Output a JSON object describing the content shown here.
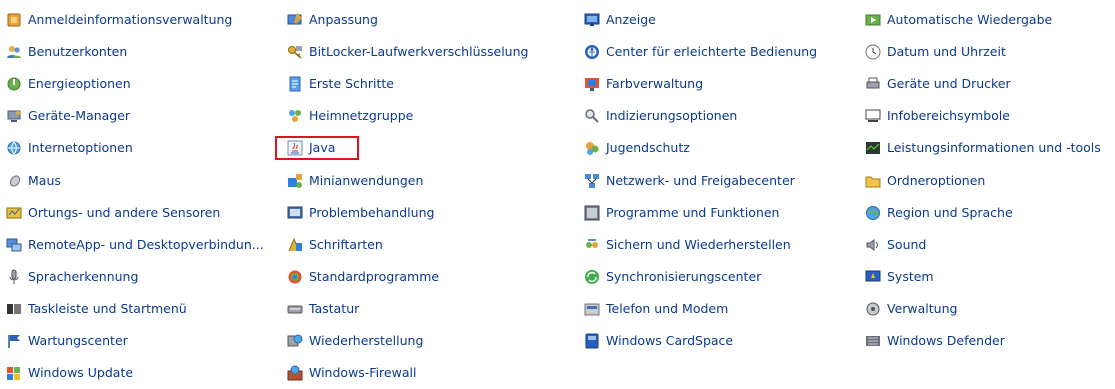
{
  "accent_link_color": "#0b3a8c",
  "highlight_color": "#e0131f",
  "columns": [
    {
      "items": [
        {
          "label": "Anmeldeinformationsverwaltung",
          "icon": "credential-vault-icon",
          "name": "item-anmeldeinformationsverwaltung"
        },
        {
          "label": "Benutzerkonten",
          "icon": "user-accounts-icon",
          "name": "item-benutzerkonten"
        },
        {
          "label": "Energieoptionen",
          "icon": "power-options-icon",
          "name": "item-energieoptionen"
        },
        {
          "label": "Geräte-Manager",
          "icon": "device-manager-icon",
          "name": "item-geraete-manager"
        },
        {
          "label": "Internetoptionen",
          "icon": "internet-options-icon",
          "name": "item-internetoptionen"
        },
        {
          "label": "Maus",
          "icon": "mouse-icon",
          "name": "item-maus"
        },
        {
          "label": "Ortungs- und andere Sensoren",
          "icon": "sensors-icon",
          "name": "item-ortungs-sensoren"
        },
        {
          "label": "RemoteApp- und Desktopverbindun...",
          "icon": "remoteapp-icon",
          "name": "item-remoteapp"
        },
        {
          "label": "Spracherkennung",
          "icon": "speech-recognition-icon",
          "name": "item-spracherkennung"
        },
        {
          "label": "Taskleiste und Startmenü",
          "icon": "taskbar-icon",
          "name": "item-taskleiste"
        },
        {
          "label": "Wartungscenter",
          "icon": "action-center-flag-icon",
          "name": "item-wartungscenter"
        },
        {
          "label": "Windows Update",
          "icon": "windows-update-icon",
          "name": "item-windows-update"
        }
      ]
    },
    {
      "items": [
        {
          "label": "Anpassung",
          "icon": "personalization-icon",
          "name": "item-anpassung"
        },
        {
          "label": "BitLocker-Laufwerkverschlüsselung",
          "icon": "bitlocker-key-icon",
          "name": "item-bitlocker"
        },
        {
          "label": "Erste Schritte",
          "icon": "getting-started-icon",
          "name": "item-erste-schritte"
        },
        {
          "label": "Heimnetzgruppe",
          "icon": "homegroup-icon",
          "name": "item-heimnetzgruppe"
        },
        {
          "label": "Java",
          "icon": "java-icon",
          "name": "item-java",
          "highlighted": true
        },
        {
          "label": "Minianwendungen",
          "icon": "gadgets-icon",
          "name": "item-minianwendungen"
        },
        {
          "label": "Problembehandlung",
          "icon": "troubleshooting-icon",
          "name": "item-problembehandlung"
        },
        {
          "label": "Schriftarten",
          "icon": "fonts-icon",
          "name": "item-schriftarten"
        },
        {
          "label": "Standardprogramme",
          "icon": "default-programs-icon",
          "name": "item-standardprogramme"
        },
        {
          "label": "Tastatur",
          "icon": "keyboard-icon",
          "name": "item-tastatur"
        },
        {
          "label": "Wiederherstellung",
          "icon": "recovery-icon",
          "name": "item-wiederherstellung"
        },
        {
          "label": "Windows-Firewall",
          "icon": "firewall-icon",
          "name": "item-windows-firewall"
        }
      ]
    },
    {
      "items": [
        {
          "label": "Anzeige",
          "icon": "display-icon",
          "name": "item-anzeige"
        },
        {
          "label": "Center für erleichterte Bedienung",
          "icon": "ease-of-access-icon",
          "name": "item-erleichterte-bedienung"
        },
        {
          "label": "Farbverwaltung",
          "icon": "color-management-icon",
          "name": "item-farbverwaltung"
        },
        {
          "label": "Indizierungsoptionen",
          "icon": "indexing-icon",
          "name": "item-indizierungsoptionen"
        },
        {
          "label": "Jugendschutz",
          "icon": "parental-controls-icon",
          "name": "item-jugendschutz"
        },
        {
          "label": "Netzwerk- und Freigabecenter",
          "icon": "network-sharing-icon",
          "name": "item-netzwerk-freigabecenter"
        },
        {
          "label": "Programme und Funktionen",
          "icon": "programs-features-icon",
          "name": "item-programme-funktionen"
        },
        {
          "label": "Sichern und Wiederherstellen",
          "icon": "backup-restore-icon",
          "name": "item-sichern-wiederherstellen"
        },
        {
          "label": "Synchronisierungscenter",
          "icon": "sync-center-icon",
          "name": "item-synchronisierungscenter"
        },
        {
          "label": "Telefon und Modem",
          "icon": "phone-modem-icon",
          "name": "item-telefon-modem"
        },
        {
          "label": "Windows CardSpace",
          "icon": "cardspace-icon",
          "name": "item-windows-cardspace"
        }
      ]
    },
    {
      "items": [
        {
          "label": "Automatische Wiedergabe",
          "icon": "autoplay-icon",
          "name": "item-automatische-wiedergabe"
        },
        {
          "label": "Datum und Uhrzeit",
          "icon": "date-time-icon",
          "name": "item-datum-uhrzeit"
        },
        {
          "label": "Geräte und Drucker",
          "icon": "devices-printers-icon",
          "name": "item-geraete-drucker"
        },
        {
          "label": "Infobereichsymbole",
          "icon": "notification-area-icon",
          "name": "item-infobereichsymbole"
        },
        {
          "label": "Leistungsinformationen und -tools",
          "icon": "performance-icon",
          "name": "item-leistungsinformationen"
        },
        {
          "label": "Ordneroptionen",
          "icon": "folder-options-icon",
          "name": "item-ordneroptionen"
        },
        {
          "label": "Region und Sprache",
          "icon": "region-language-icon",
          "name": "item-region-sprache"
        },
        {
          "label": "Sound",
          "icon": "sound-icon",
          "name": "item-sound"
        },
        {
          "label": "System",
          "icon": "system-icon",
          "name": "item-system"
        },
        {
          "label": "Verwaltung",
          "icon": "administrative-tools-icon",
          "name": "item-verwaltung"
        },
        {
          "label": "Windows Defender",
          "icon": "windows-defender-icon",
          "name": "item-windows-defender"
        }
      ]
    }
  ]
}
